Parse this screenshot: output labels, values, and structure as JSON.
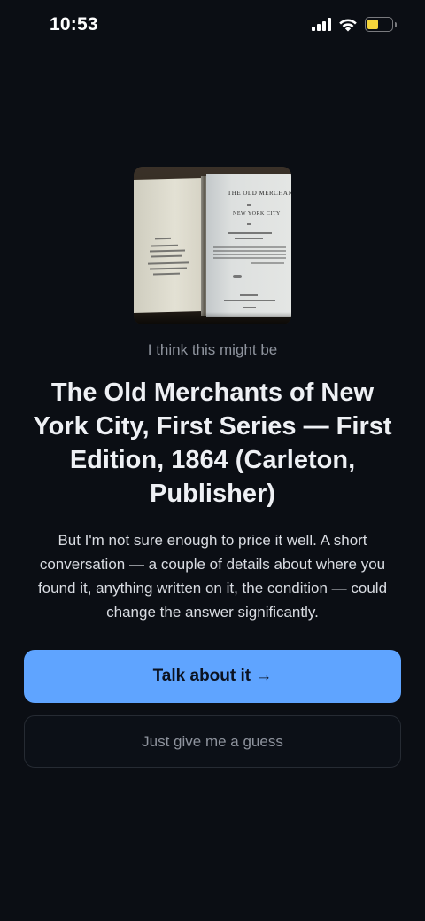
{
  "status_bar": {
    "time": "10:53",
    "icons": [
      "cellular-signal-icon",
      "wifi-icon",
      "battery-icon"
    ],
    "battery_color": "#f5d53b"
  },
  "photo": {
    "page_title_line1": "THE OLD MERCHANTS",
    "page_title_line2": "NEW YORK CITY"
  },
  "lead_text": "I think this might be",
  "title": "The Old Merchants of New York City, First Series — First Edition, 1864 (Carleton, Publisher)",
  "body": "But I'm not sure enough to price it well. A short conversation — a couple of details about where you found it, anything written on it, the condition — could change the answer significantly.",
  "actions": {
    "primary_label": "Talk about it →",
    "secondary_label": "Just give me a guess"
  },
  "colors": {
    "background": "#0b0e14",
    "primary_button": "#5fa4ff"
  }
}
